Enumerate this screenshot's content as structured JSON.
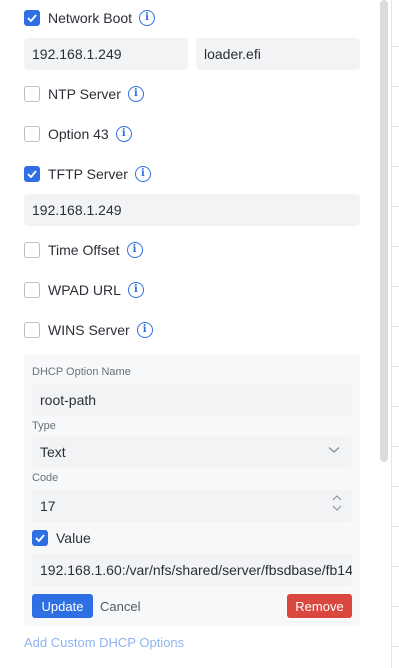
{
  "options": {
    "network_boot": {
      "label": "Network Boot",
      "checked": true,
      "server": "192.168.1.249",
      "filename": "loader.efi"
    },
    "ntp_server": {
      "label": "NTP Server",
      "checked": false
    },
    "option_43": {
      "label": "Option 43",
      "checked": false
    },
    "tftp_server": {
      "label": "TFTP Server",
      "checked": true,
      "value": "192.168.1.249"
    },
    "time_offset": {
      "label": "Time Offset",
      "checked": false
    },
    "wpad_url": {
      "label": "WPAD URL",
      "checked": false
    },
    "wins_server": {
      "label": "WINS Server",
      "checked": false
    }
  },
  "custom_option": {
    "name_label": "DHCP Option Name",
    "name_value": "root-path",
    "type_label": "Type",
    "type_value": "Text",
    "code_label": "Code",
    "code_value": "17",
    "value_label": "Value",
    "value_checked": true,
    "value_value": "192.168.1.60:/var/nfs/shared/server/fbsdbase/fb14"
  },
  "actions": {
    "update": "Update",
    "cancel": "Cancel",
    "remove": "Remove",
    "add_custom": "Add Custom DHCP Options"
  },
  "colors": {
    "accent": "#2f6fe4",
    "danger": "#d9473f",
    "field_bg": "#f2f3f5"
  },
  "icons": [
    "check-icon",
    "info-icon",
    "chevron-down-icon",
    "spin-up-icon",
    "spin-down-icon"
  ]
}
